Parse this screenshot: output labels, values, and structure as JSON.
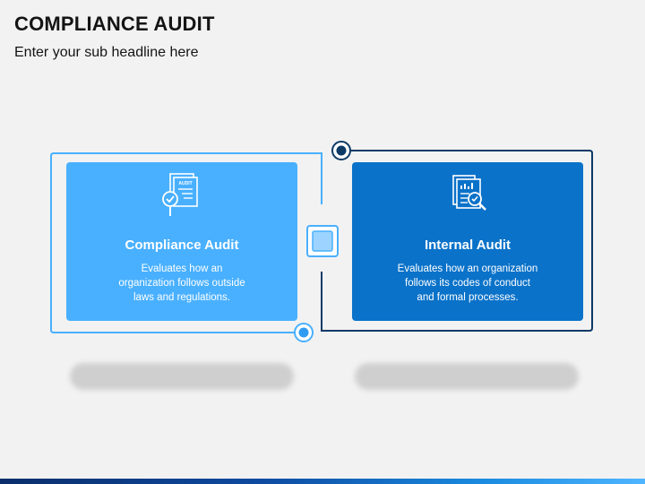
{
  "header": {
    "title": "COMPLIANCE AUDIT",
    "subtitle": "Enter your sub headline here"
  },
  "cards": [
    {
      "heading": "Compliance Audit",
      "body_lines": [
        "Evaluates how an",
        "organization follows outside",
        "laws and regulations."
      ],
      "icon": "audit-document-check-icon",
      "color": "#49b0ff"
    },
    {
      "heading": "Internal Audit",
      "body_lines": [
        "Evaluates how an organization",
        "follows its codes of conduct",
        "and formal processes."
      ],
      "icon": "report-magnifier-icon",
      "color": "#0a72c9"
    }
  ],
  "icon_text": "AUDIT",
  "colors": {
    "light_blue": "#49b0ff",
    "dark_blue": "#0a72c9",
    "navy": "#0d3a66",
    "background": "#f2f2f2"
  }
}
